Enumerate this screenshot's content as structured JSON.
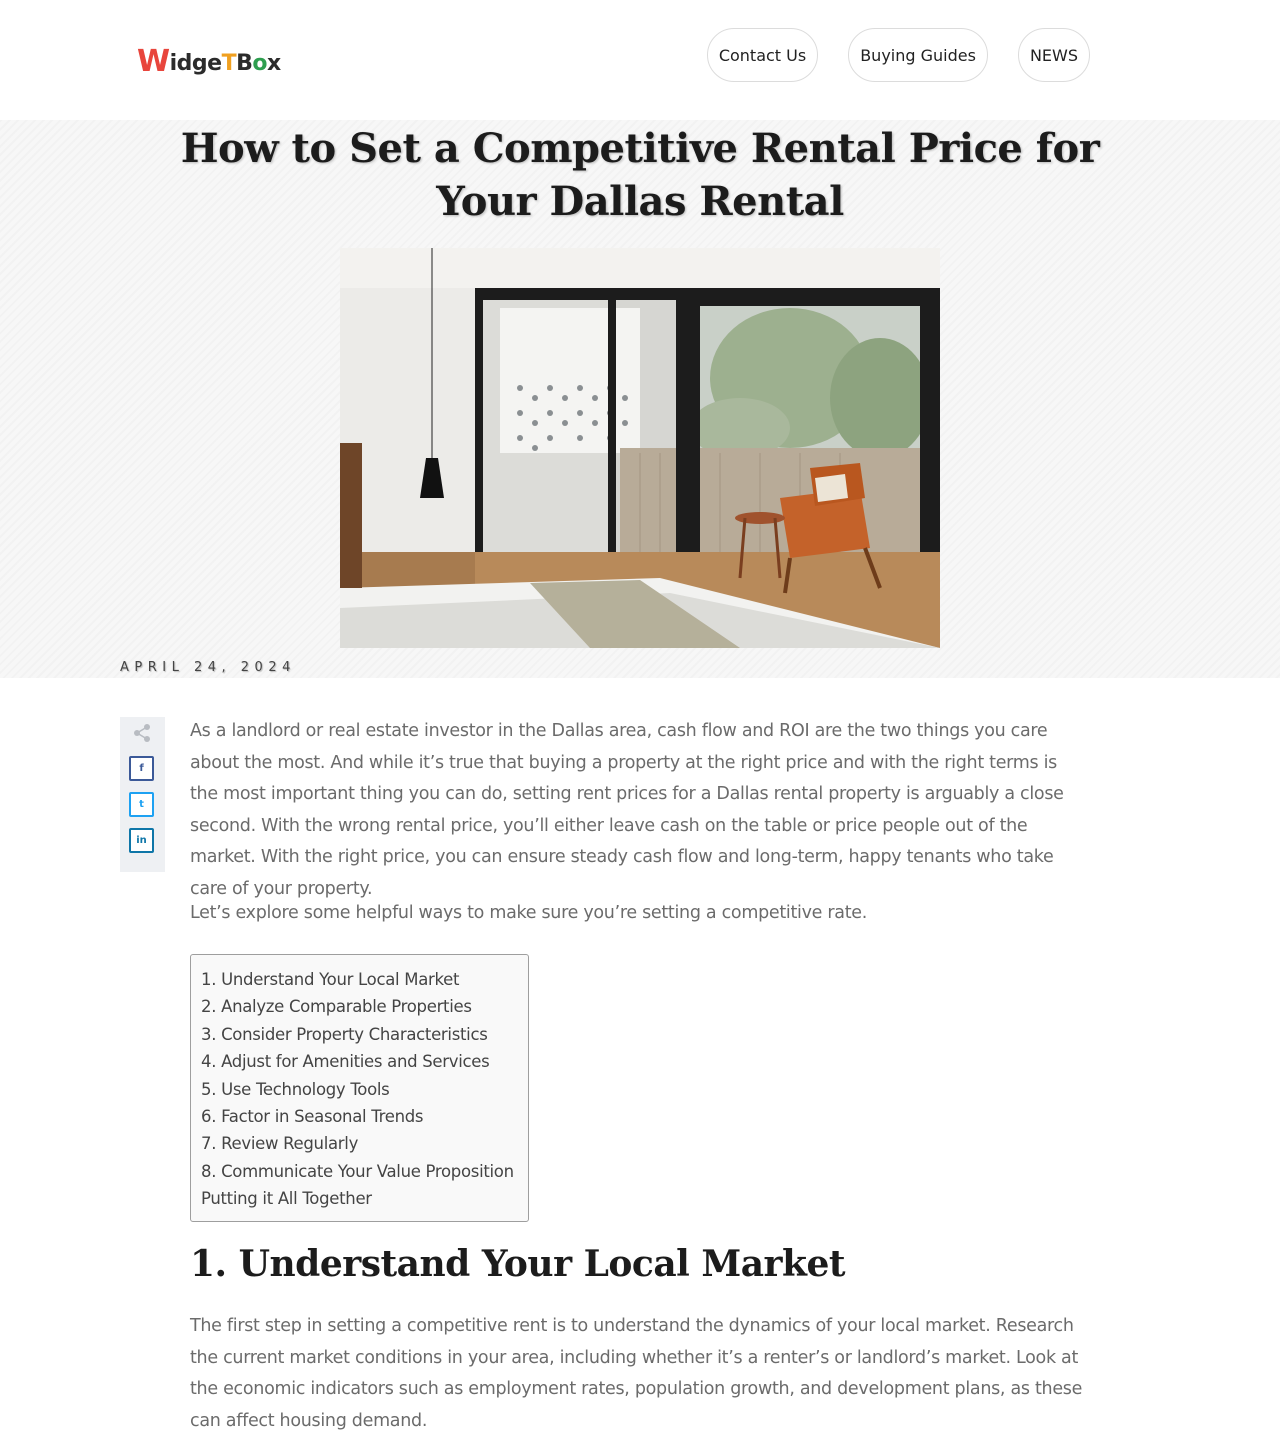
{
  "header": {
    "logo": {
      "part1": "W",
      "part2": "idge",
      "part3": "T",
      "part4": "B",
      "part5": "o",
      "part6": "x"
    },
    "nav": [
      {
        "label": "Contact Us"
      },
      {
        "label": "Buying Guides"
      },
      {
        "label": "NEWS"
      }
    ]
  },
  "post": {
    "title": "How to Set a Competitive Rental Price for Your Dallas Rental",
    "date": "APRIL 24, 2024",
    "hero_image": "bedroom with large glass doors opening to a balcony with an orange lounge chair and trees",
    "intro": "As a landlord or real estate investor in the Dallas area, cash flow and ROI are the two things you care about the most. And while it’s true that buying a property at the right price and with the right terms is the most important thing you can do, setting rent prices for a Dallas rental property is arguably a close second. With the wrong rental price, you’ll either leave cash on the table or price people out of the market. With the right price, you can ensure steady cash flow and long-term, happy tenants who take care of your property.",
    "lead": "Let’s explore some helpful ways to make sure you’re setting a competitive rate.",
    "toc": [
      "1. Understand Your Local Market",
      "2. Analyze Comparable Properties",
      "3. Consider Property Characteristics",
      "4. Adjust for Amenities and Services",
      "5. Use Technology Tools",
      "6. Factor in Seasonal Trends",
      "7. Review Regularly",
      "8. Communicate Your Value Proposition",
      "Putting it All Together"
    ],
    "section1_heading": "1. Understand Your Local Market",
    "section1_body": "The first step in setting a competitive rent is to understand the dynamics of your local market. Research the current market conditions in your area, including whether it’s a renter’s or landlord’s market. Look at the economic indicators such as employment rates, population growth, and development plans, as these can affect housing demand."
  },
  "share": {
    "icons": [
      "share-icon",
      "facebook-icon",
      "twitter-icon",
      "linkedin-icon"
    ],
    "facebook": "f",
    "twitter": "t",
    "linkedin": "in"
  }
}
